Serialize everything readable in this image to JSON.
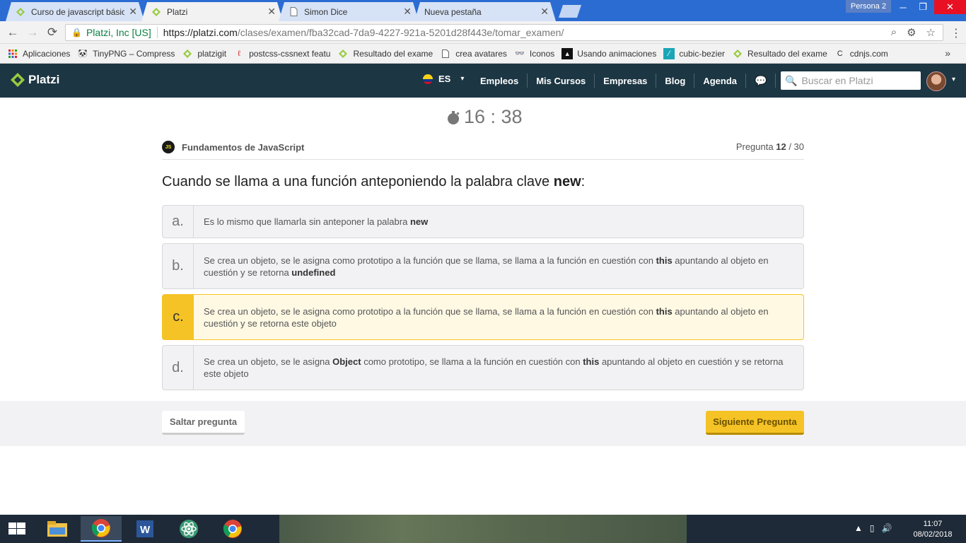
{
  "browser": {
    "tabs": [
      {
        "label": "Curso de javascript básico",
        "active": false
      },
      {
        "label": "Platzi",
        "active": true
      },
      {
        "label": "Simon Dice",
        "active": false
      },
      {
        "label": "Nueva pestaña",
        "active": false
      }
    ],
    "profile": "Persona 2",
    "address": {
      "secure_label": "Platzi, Inc [US]",
      "url_host": "https://platzi.com",
      "url_path": "/clases/examen/fba32cad-7da9-4227-921a-5201d28f443e/tomar_examen/"
    },
    "bookmarks": [
      {
        "label": "Aplicaciones",
        "icon": "apps-grid-icon"
      },
      {
        "label": "TinyPNG – Compress",
        "icon": "panda-icon"
      },
      {
        "label": "platzigit",
        "icon": "platzi-icon"
      },
      {
        "label": "postcss-cssnext featu",
        "icon": "postcss-icon"
      },
      {
        "label": "Resultado del exame",
        "icon": "platzi-icon"
      },
      {
        "label": "crea avatares",
        "icon": "page-icon"
      },
      {
        "label": "Iconos",
        "icon": "binoculars-icon"
      },
      {
        "label": "Usando animaciones",
        "icon": "mdn-icon"
      },
      {
        "label": "cubic-bezier",
        "icon": "curve-icon"
      },
      {
        "label": "Resultado del exame",
        "icon": "platzi-icon"
      },
      {
        "label": "cdnjs.com",
        "icon": "cdnjs-icon"
      }
    ]
  },
  "header": {
    "brand": "Platzi",
    "lang": "ES",
    "nav": [
      "Empleos",
      "Mis Cursos",
      "Empresas",
      "Blog",
      "Agenda"
    ],
    "search_placeholder": "Buscar en Platzi"
  },
  "exam": {
    "timer": "16 : 38",
    "course_badge": "JS",
    "course": "Fundamentos de JavaScript",
    "counter_label": "Pregunta",
    "current": "12",
    "total": "/ 30",
    "question_prefix": "Cuando se llama a una función anteponiendo la palabra clave ",
    "question_keyword": "new",
    "question_suffix": ":",
    "options": [
      {
        "letter": "a.",
        "parts": [
          [
            "Es lo mismo que llamarla sin anteponer la palabra ",
            false
          ],
          [
            "new",
            true
          ]
        ],
        "selected": false
      },
      {
        "letter": "b.",
        "parts": [
          [
            "Se crea un objeto, se le asigna como prototipo a la función que se llama, se llama a la función en cuestión con ",
            false
          ],
          [
            "this",
            true
          ],
          [
            " apuntando al objeto en cuestión y se retorna ",
            false
          ],
          [
            "undefined",
            true
          ]
        ],
        "selected": false
      },
      {
        "letter": "c.",
        "parts": [
          [
            "Se crea un objeto, se le asigna como prototipo a la función que se llama, se llama a la función en cuestión con ",
            false
          ],
          [
            "this",
            true
          ],
          [
            " apuntando al objeto en cuestión y se retorna este objeto",
            false
          ]
        ],
        "selected": true
      },
      {
        "letter": "d.",
        "parts": [
          [
            "Se crea un objeto, se le asigna ",
            false
          ],
          [
            "Object",
            true
          ],
          [
            " como prototipo, se llama a la función en cuestión con ",
            false
          ],
          [
            "this",
            true
          ],
          [
            " apuntando al objeto en cuestión y se retorna este objeto",
            false
          ]
        ],
        "selected": false
      }
    ],
    "skip_label": "Saltar pregunta",
    "next_label": "Siguiente Pregunta"
  },
  "taskbar": {
    "apps": [
      "file-explorer-icon",
      "chrome-icon",
      "word-icon",
      "atom-icon",
      "chrome-icon"
    ],
    "time": "11:07",
    "date": "08/02/2018"
  },
  "colors": {
    "accent": "#f5c325",
    "header": "#1c3643",
    "brand_green": "#98ca3f"
  }
}
